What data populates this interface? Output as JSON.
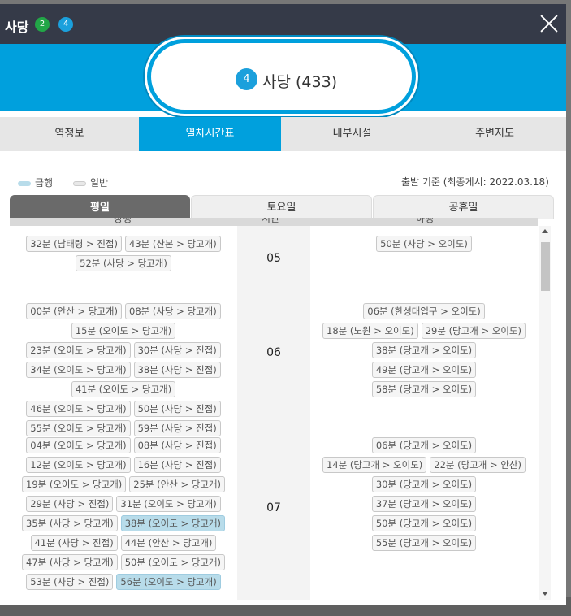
{
  "header": {
    "title": "사당",
    "lines": [
      "2",
      "4"
    ]
  },
  "station": {
    "line_no": "4",
    "name": "사당 (433)"
  },
  "tabs": [
    "역정보",
    "열차시간표",
    "내부시설",
    "주변지도"
  ],
  "active_tab": 1,
  "legend": {
    "express": "급행",
    "normal": "일반",
    "express_color": "#b8dcea",
    "normal_color": "#e8e8e8"
  },
  "basis": "출발 기준 (최종게시: 2022.03.18)",
  "day_tabs": [
    "평일",
    "토요일",
    "공휴일"
  ],
  "table_headers": [
    "상행",
    "시간",
    "하행"
  ],
  "rows": [
    {
      "hour": "05",
      "up": [
        {
          "t": "32분 (남태령 > 진접)"
        },
        {
          "t": "43분 (산본 > 당고개)"
        },
        {
          "t": "52분 (사당 > 당고개)"
        }
      ],
      "down": [
        {
          "t": "50분 (사당 > 오이도)"
        }
      ]
    },
    {
      "hour": "06",
      "up": [
        {
          "t": "00분 (안산 > 당고개)"
        },
        {
          "t": "08분 (사당 > 당고개)"
        },
        {
          "t": "15분 (오이도 > 당고개)"
        },
        {
          "t": "23분 (오이도 > 당고개)"
        },
        {
          "t": "30분 (사당 > 진접)"
        },
        {
          "t": "34분 (오이도 > 당고개)"
        },
        {
          "t": "38분 (사당 > 진접)"
        },
        {
          "t": "41분 (오이도 > 당고개)"
        },
        {
          "t": "46분 (오이도 > 당고개)"
        },
        {
          "t": "50분 (사당 > 진접)"
        },
        {
          "t": "55분 (오이도 > 당고개)"
        },
        {
          "t": "59분 (사당 > 진접)"
        }
      ],
      "down": [
        {
          "t": "06분 (한성대입구 > 오이도)"
        },
        {
          "t": "18분 (노원 > 오이도)"
        },
        {
          "t": "29분 (당고개 > 오이도)"
        },
        {
          "t": "38분 (당고개 > 오이도)"
        },
        {
          "t": "49분 (당고개 > 오이도)"
        },
        {
          "t": "58분 (당고개 > 오이도)"
        }
      ]
    },
    {
      "hour": "07",
      "up": [
        {
          "t": "04분 (오이도 > 당고개)"
        },
        {
          "t": "08분 (사당 > 진접)"
        },
        {
          "t": "12분 (오이도 > 당고개)"
        },
        {
          "t": "16분 (사당 > 진접)"
        },
        {
          "t": "19분 (오이도 > 당고개)"
        },
        {
          "t": "25분 (안산 > 당고개)"
        },
        {
          "t": "29분 (사당 > 진접)"
        },
        {
          "t": "31분 (오이도 > 당고개)"
        },
        {
          "t": "35분 (사당 > 당고개)"
        },
        {
          "t": "38분 (오이도 > 당고개)",
          "express": true
        },
        {
          "t": "41분 (사당 > 진접)"
        },
        {
          "t": "44분 (안산 > 당고개)"
        },
        {
          "t": "47분 (사당 > 당고개)"
        },
        {
          "t": "50분 (오이도 > 당고개)"
        },
        {
          "t": "53분 (사당 > 진접)"
        },
        {
          "t": "56분 (오이도 > 당고개)",
          "express": true
        }
      ],
      "down": [
        {
          "t": "06분 (당고개 > 오이도)"
        },
        {
          "t": "14분 (당고개 > 오이도)"
        },
        {
          "t": "22분 (당고개 > 안산)"
        },
        {
          "t": "30분 (당고개 > 오이도)"
        },
        {
          "t": "37분 (당고개 > 오이도)"
        },
        {
          "t": "50분 (당고개 > 오이도)"
        },
        {
          "t": "55분 (당고개 > 오이도)"
        }
      ]
    }
  ]
}
